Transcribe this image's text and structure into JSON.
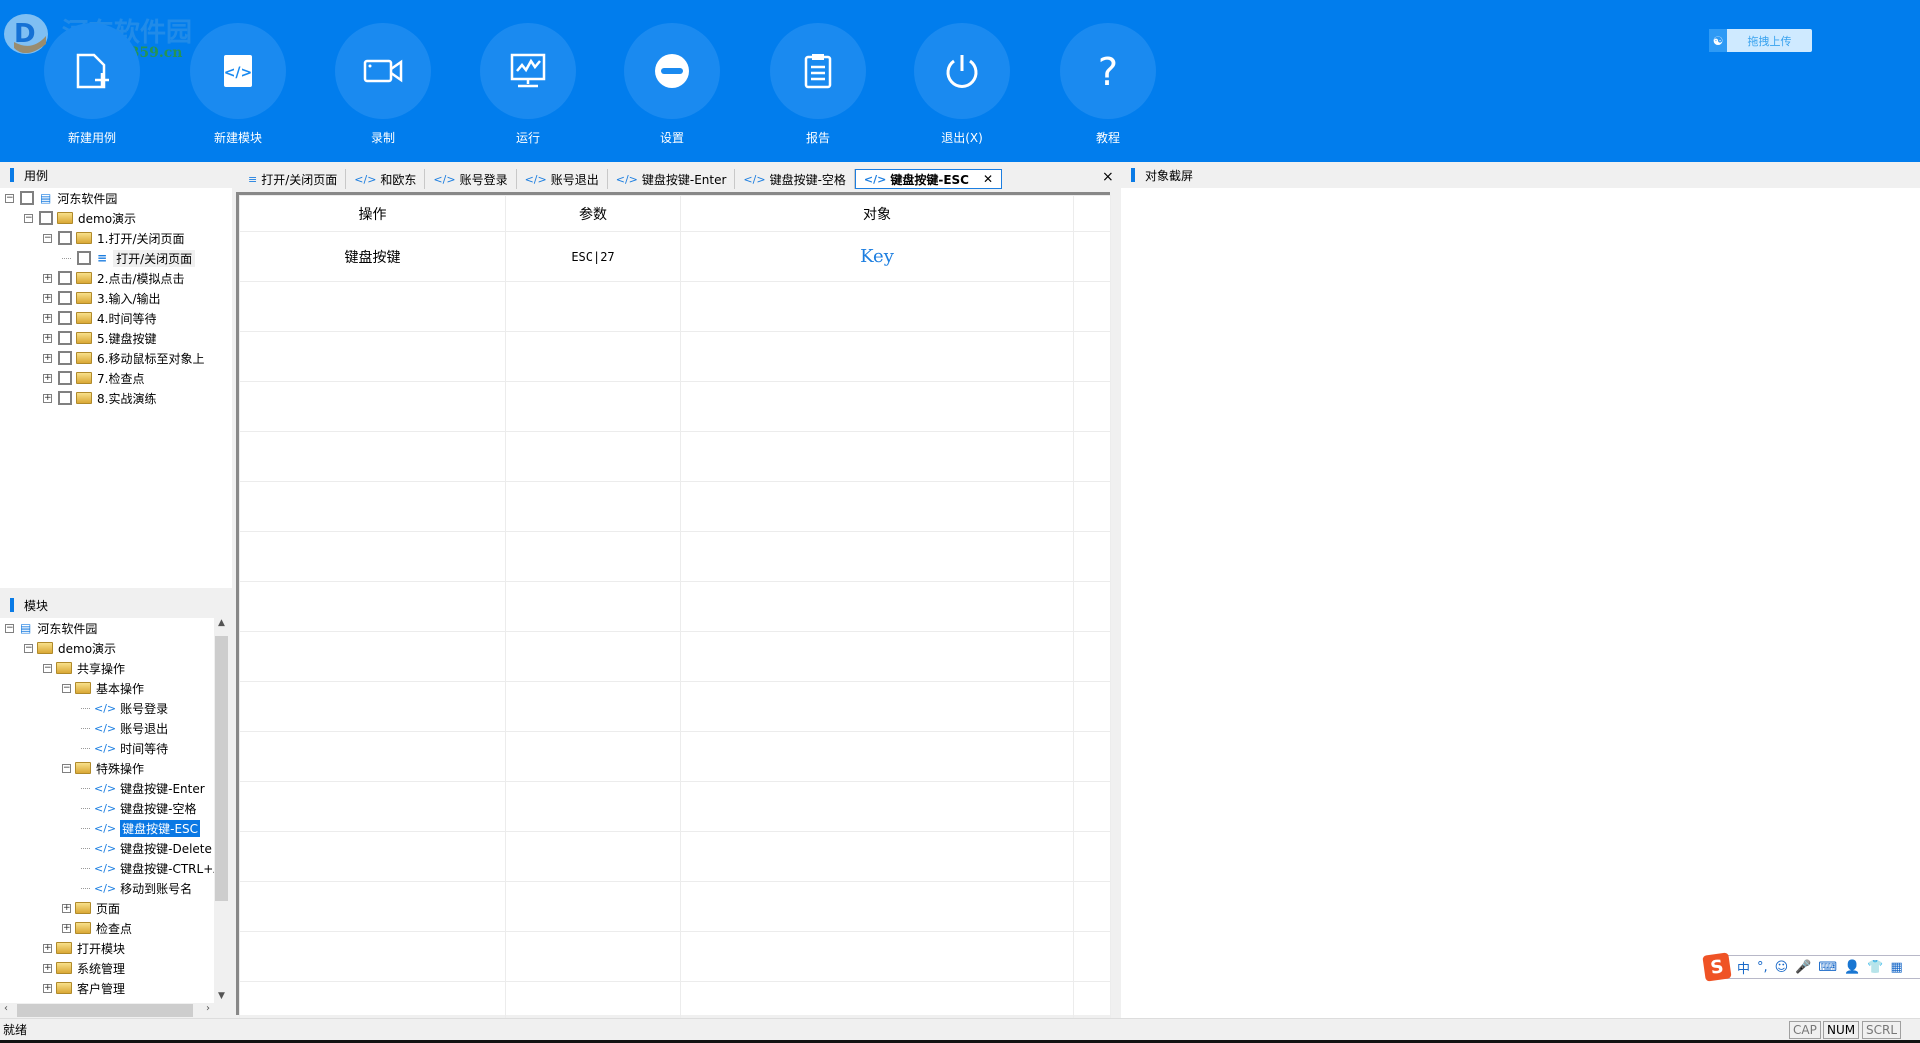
{
  "toolbar": {
    "logo_text": "河东软件园",
    "logo_url": "www.pc0359.cn",
    "buttons": [
      {
        "label": "新建用例",
        "icon": "new-file-icon"
      },
      {
        "label": "新建模块",
        "icon": "code-icon"
      },
      {
        "label": "录制",
        "icon": "video-camera-icon"
      },
      {
        "label": "运行",
        "icon": "monitor-chart-icon"
      },
      {
        "label": "设置",
        "icon": "minus-circle-icon"
      },
      {
        "label": "报告",
        "icon": "clipboard-icon"
      },
      {
        "label": "退出(X)",
        "icon": "power-icon"
      },
      {
        "label": "教程",
        "icon": "question-icon"
      }
    ],
    "upload_label": "拖拽上传"
  },
  "cases": {
    "title": "用例",
    "items": [
      {
        "label": "河东软件园",
        "level": 0,
        "exp": "-",
        "type": "list"
      },
      {
        "label": "demo演示",
        "level": 1,
        "exp": "-",
        "type": "folder"
      },
      {
        "label": "1.打开/关闭页面",
        "level": 2,
        "exp": "-",
        "type": "folder"
      },
      {
        "label": "打开/关闭页面",
        "level": 3,
        "exp": "",
        "type": "case"
      },
      {
        "label": "2.点击/模拟点击",
        "level": 2,
        "exp": "+",
        "type": "folder"
      },
      {
        "label": "3.输入/输出",
        "level": 2,
        "exp": "+",
        "type": "folder"
      },
      {
        "label": "4.时间等待",
        "level": 2,
        "exp": "+",
        "type": "folder"
      },
      {
        "label": "5.键盘按键",
        "level": 2,
        "exp": "+",
        "type": "folder"
      },
      {
        "label": "6.移动鼠标至对象上",
        "level": 2,
        "exp": "+",
        "type": "folder"
      },
      {
        "label": "7.检查点",
        "level": 2,
        "exp": "+",
        "type": "folder"
      },
      {
        "label": "8.实战演练",
        "level": 2,
        "exp": "+",
        "type": "folder"
      }
    ]
  },
  "modules": {
    "title": "模块",
    "items": [
      {
        "label": "河东软件园",
        "level": 0,
        "exp": "-",
        "type": "list"
      },
      {
        "label": "demo演示",
        "level": 1,
        "exp": "-",
        "type": "folder"
      },
      {
        "label": "共享操作",
        "level": 2,
        "exp": "-",
        "type": "folder"
      },
      {
        "label": "基本操作",
        "level": 3,
        "exp": "-",
        "type": "folder"
      },
      {
        "label": "账号登录",
        "level": 4,
        "exp": "",
        "type": "code"
      },
      {
        "label": "账号退出",
        "level": 4,
        "exp": "",
        "type": "code"
      },
      {
        "label": "时间等待",
        "level": 4,
        "exp": "",
        "type": "code"
      },
      {
        "label": "特殊操作",
        "level": 3,
        "exp": "-",
        "type": "folder"
      },
      {
        "label": "键盘按键-Enter",
        "level": 4,
        "exp": "",
        "type": "code"
      },
      {
        "label": "键盘按键-空格",
        "level": 4,
        "exp": "",
        "type": "code"
      },
      {
        "label": "键盘按键-ESC",
        "level": 4,
        "exp": "",
        "type": "code",
        "selected": true
      },
      {
        "label": "键盘按键-Delete",
        "level": 4,
        "exp": "",
        "type": "code"
      },
      {
        "label": "键盘按键-CTRL+A",
        "level": 4,
        "exp": "",
        "type": "code"
      },
      {
        "label": "移动到账号名",
        "level": 4,
        "exp": "",
        "type": "code"
      },
      {
        "label": "页面",
        "level": 3,
        "exp": "+",
        "type": "folder"
      },
      {
        "label": "检查点",
        "level": 3,
        "exp": "+",
        "type": "folder"
      },
      {
        "label": "打开模块",
        "level": 2,
        "exp": "+",
        "type": "folder"
      },
      {
        "label": "系统管理",
        "level": 2,
        "exp": "+",
        "type": "folder"
      },
      {
        "label": "客户管理",
        "level": 2,
        "exp": "+",
        "type": "folder"
      }
    ]
  },
  "tabs": [
    {
      "label": "打开/关闭页面",
      "icon": "list"
    },
    {
      "label": "和欧东",
      "icon": "code"
    },
    {
      "label": "账号登录",
      "icon": "code"
    },
    {
      "label": "账号退出",
      "icon": "code"
    },
    {
      "label": "键盘按键-Enter",
      "icon": "code"
    },
    {
      "label": "键盘按键-空格",
      "icon": "code"
    },
    {
      "label": "键盘按键-ESC",
      "icon": "code",
      "active": true
    }
  ],
  "close_all": "×",
  "table": {
    "headers": [
      "操作",
      "参数",
      "对象"
    ],
    "rows": [
      [
        "键盘按键",
        "ESC|27",
        "Key"
      ]
    ]
  },
  "screenshot_panel": {
    "title": "对象截屏"
  },
  "ime": {
    "items": [
      "中",
      "°,",
      "☺",
      "🎤",
      "⌨",
      "👤",
      "👕",
      "▦"
    ]
  },
  "status": {
    "text": "就绪",
    "cap": "CAP",
    "num": "NUM",
    "scrl": "SCRL"
  },
  "colors": {
    "toolbar": "#017ded",
    "accent": "#0a78e4"
  }
}
